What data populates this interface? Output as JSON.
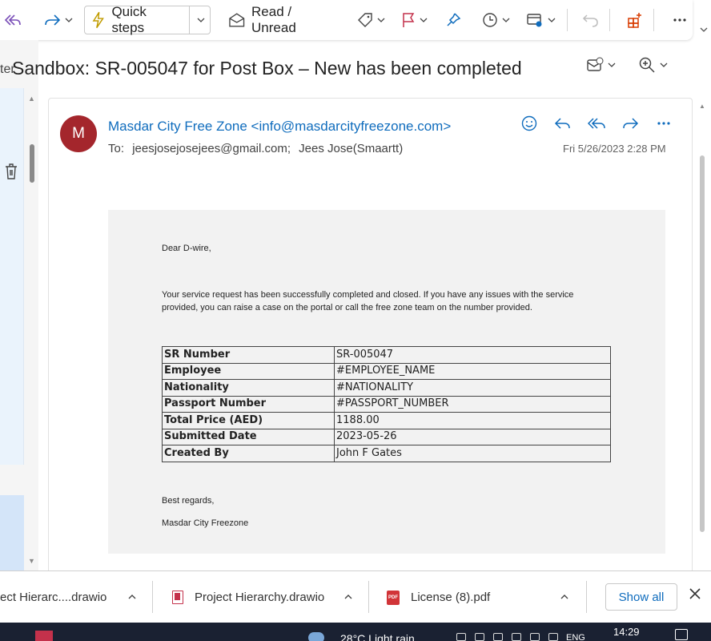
{
  "toolbar": {
    "quick_steps_label": "Quick steps",
    "read_unread_label": "Read / Unread"
  },
  "left_pane": {
    "filter_text_fragment": "ter"
  },
  "message": {
    "subject": "Sandbox: SR-005047 for Post Box – New has been completed",
    "sender_initial": "M",
    "sender": "Masdar City Free Zone <info@masdarcityfreezone.com>",
    "to_label": "To:",
    "recipients": [
      "jeesjosejosejees@gmail.com;",
      "Jees Jose(Smaartt)"
    ],
    "date": "Fri 5/26/2023 2:28 PM",
    "colors": {
      "avatar": "#a4262c",
      "sender_link": "#0f6cbd"
    }
  },
  "body": {
    "greeting": "Dear D-wire,",
    "paragraph": "Your service request has been successfully completed and closed. If you have any issues with the service provided, you can raise a case on the portal or call the free zone team on the number provided.",
    "table": [
      {
        "key": "SR Number",
        "value": "SR-005047"
      },
      {
        "key": "Employee",
        "value": "#EMPLOYEE_NAME"
      },
      {
        "key": "Nationality",
        "value": "#NATIONALITY"
      },
      {
        "key": "Passport Number",
        "value": "#PASSPORT_NUMBER"
      },
      {
        "key": "Total Price (AED)",
        "value": "1188.00"
      },
      {
        "key": "Submitted Date",
        "value": "2023-05-26"
      },
      {
        "key": "Created By",
        "value": "John F Gates"
      }
    ],
    "regards": "Best regards,",
    "signature": "Masdar City Freezone"
  },
  "downloads": {
    "items": [
      {
        "name": "ect Hierarc....drawio",
        "icon": "drawio-file-icon"
      },
      {
        "name": "Project Hierarchy.drawio",
        "icon": "drawio-file-icon"
      },
      {
        "name": "License (8).pdf",
        "icon": "pdf-file-icon"
      }
    ],
    "show_all_label": "Show all",
    "pdf_badge": "PDF"
  },
  "taskbar": {
    "weather": "28°C  Light rain",
    "lang": "ENG",
    "time": "14:29"
  }
}
